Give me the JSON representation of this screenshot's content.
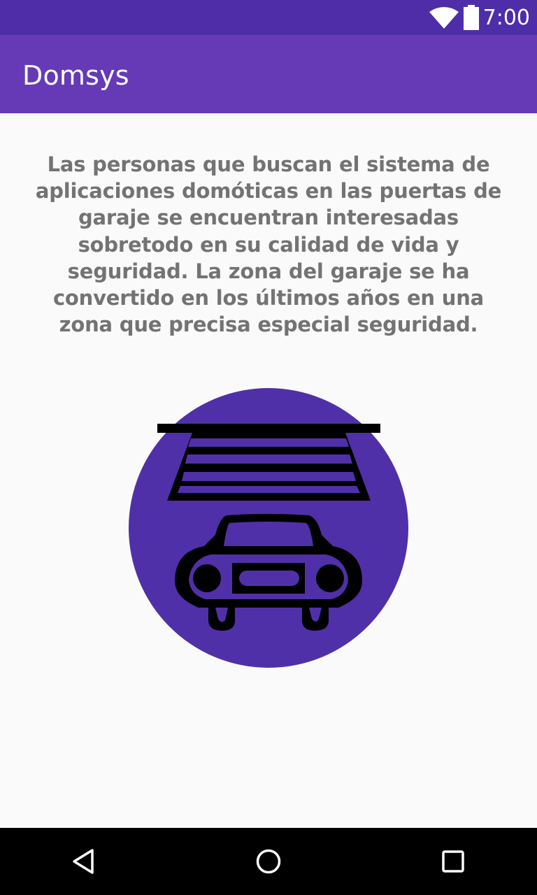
{
  "status_bar": {
    "time": "7:00",
    "icons": [
      "wifi-icon",
      "battery-icon"
    ]
  },
  "app_bar": {
    "title": "Domsys"
  },
  "main": {
    "description": "Las personas que buscan el sistema de aplicaciones domóticas en las puertas de garaje se encuentran interesadas sobretodo en su calidad de vida y seguridad. La zona del garaje se ha convertido en los últimos años en una zona que precisa especial seguridad.",
    "illustration": "garage-car-icon"
  },
  "nav_bar": {
    "buttons": [
      "back-icon",
      "home-icon",
      "recents-icon"
    ]
  },
  "colors": {
    "status_bar": "#4f2da8",
    "app_bar": "#663ab6",
    "circle": "#5030a8",
    "text": "#737373",
    "background": "#fafafa"
  }
}
